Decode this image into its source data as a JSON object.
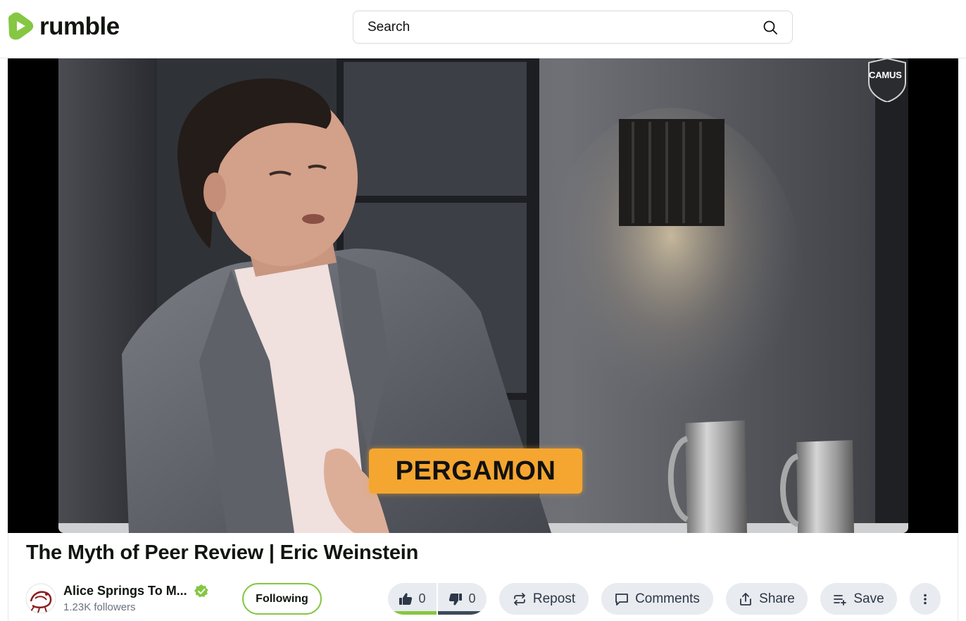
{
  "brand": {
    "name": "rumble",
    "accent": "#85c742"
  },
  "search": {
    "placeholder": "Search",
    "icon": "search-icon"
  },
  "video": {
    "watermark": "CAMUS",
    "caption": "PERGAMON",
    "caption_color": "#f5a630"
  },
  "title": "The Myth of Peer Review | Eric Weinstein",
  "channel": {
    "name": "Alice Springs To M...",
    "followers": "1.23K followers",
    "verified": true,
    "verified_icon": "verified-check-icon"
  },
  "follow_button": {
    "label": "Following"
  },
  "votes": {
    "likes": "0",
    "dislikes": "0"
  },
  "actions": {
    "repost": "Repost",
    "comments": "Comments",
    "share": "Share",
    "save": "Save",
    "more_icon": "more-vertical-icon"
  }
}
